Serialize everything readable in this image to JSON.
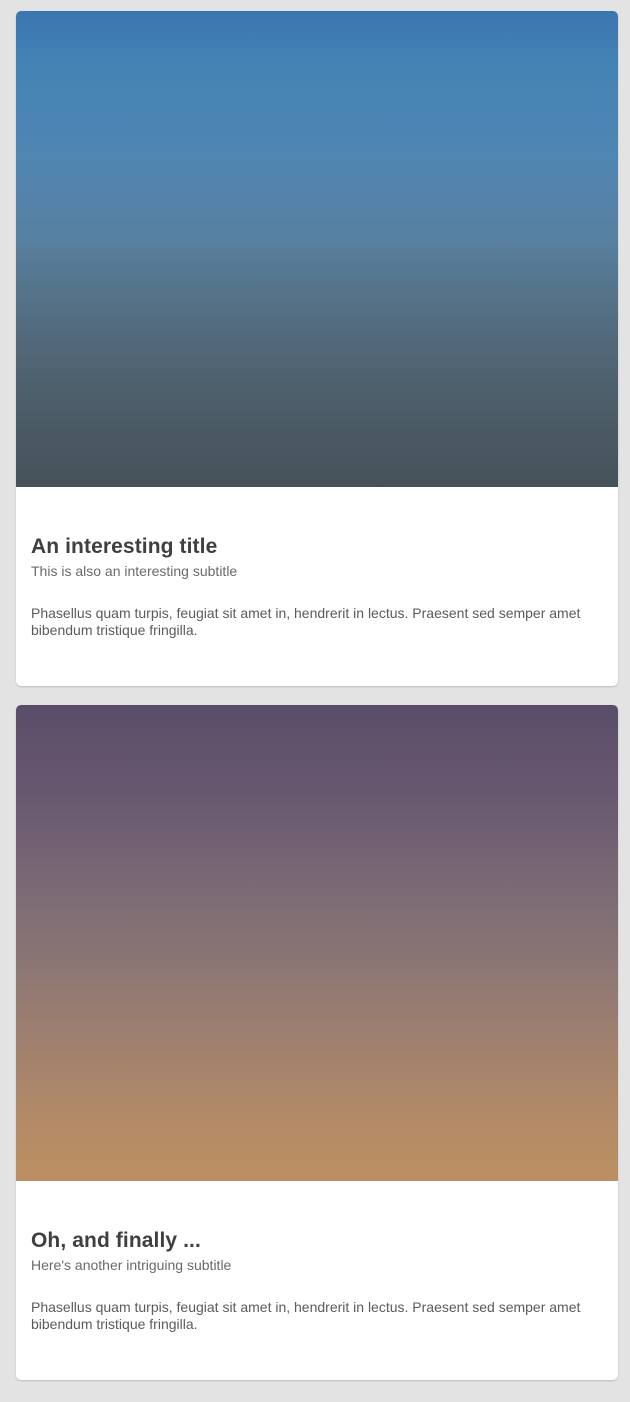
{
  "cards": [
    {
      "title": "An interesting title",
      "subtitle": "This is also an interesting subtitle",
      "body": "Phasellus quam turpis, feugiat sit amet in, hendrerit in lectus. Praesent sed semper amet bibendum tristique fringilla."
    },
    {
      "title": "Oh, and finally ...",
      "subtitle": "Here's another intriguing subtitle",
      "body": "Phasellus quam turpis, feugiat sit amet in, hendrerit in lectus. Praesent sed semper amet bibendum tristique fringilla."
    }
  ]
}
